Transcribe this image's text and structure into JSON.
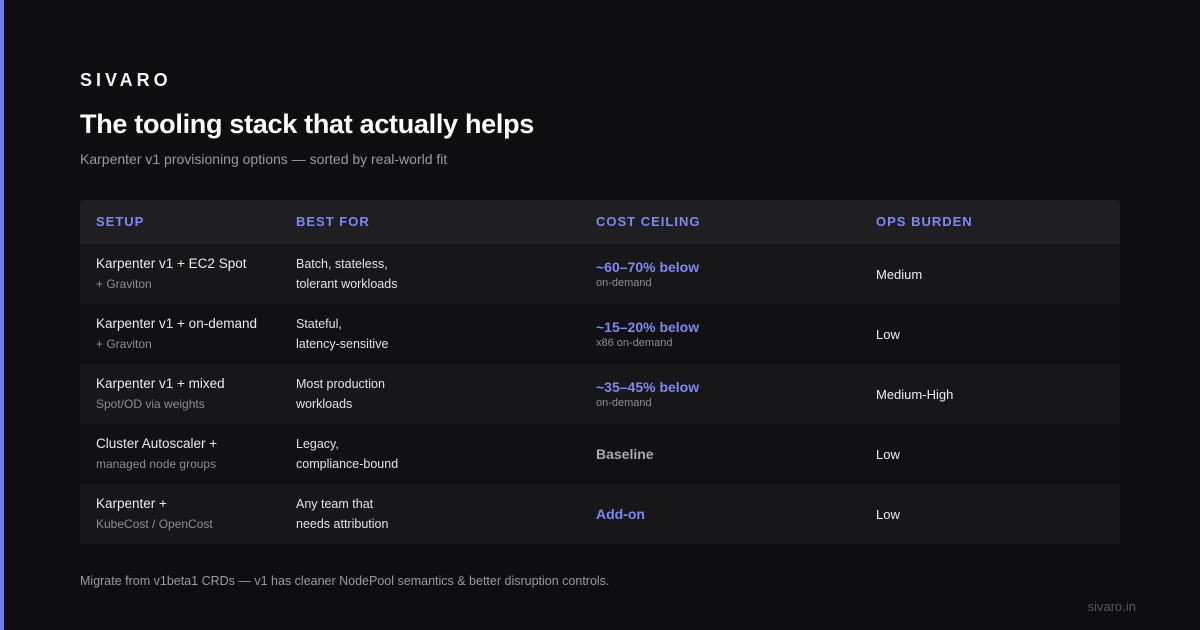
{
  "brand": "SIVARO",
  "title": "The tooling stack that actually helps",
  "subtitle": "Karpenter v1 provisioning options — sorted by real-world fit",
  "colors": {
    "accent": "#6e7bf2",
    "header_text": "#7f88f0",
    "background": "#0e0e10"
  },
  "table": {
    "headers": [
      "SETUP",
      "BEST FOR",
      "COST CEILING",
      "OPS BURDEN"
    ],
    "rows": [
      {
        "setup": "Karpenter v1 + EC2 Spot",
        "setup_sub": "+ Graviton",
        "best_for_1": "Batch, stateless,",
        "best_for_2": "tolerant workloads",
        "cost": "~60–70% below",
        "cost_sub": "on-demand",
        "ops": "Medium"
      },
      {
        "setup": "Karpenter v1 + on-demand",
        "setup_sub": "+ Graviton",
        "best_for_1": "Stateful,",
        "best_for_2": "latency-sensitive",
        "cost": "~15–20% below",
        "cost_sub": "x86 on-demand",
        "ops": "Low"
      },
      {
        "setup": "Karpenter v1 + mixed",
        "setup_sub": "Spot/OD via weights",
        "best_for_1": "Most production",
        "best_for_2": "workloads",
        "cost": "~35–45% below",
        "cost_sub": "on-demand",
        "ops": "Medium-High"
      },
      {
        "setup": "Cluster Autoscaler +",
        "setup_sub": "managed node groups",
        "best_for_1": "Legacy,",
        "best_for_2": "compliance-bound",
        "cost": "Baseline",
        "cost_sub": "",
        "ops": "Low"
      },
      {
        "setup": "Karpenter +",
        "setup_sub": "KubeCost / OpenCost",
        "best_for_1": "Any team that",
        "best_for_2": "needs attribution",
        "cost": "Add-on",
        "cost_sub": "",
        "ops": "Low"
      }
    ]
  },
  "footnote": "Migrate from v1beta1 CRDs — v1 has cleaner NodePool semantics & better disruption controls.",
  "site": "sivaro.in"
}
